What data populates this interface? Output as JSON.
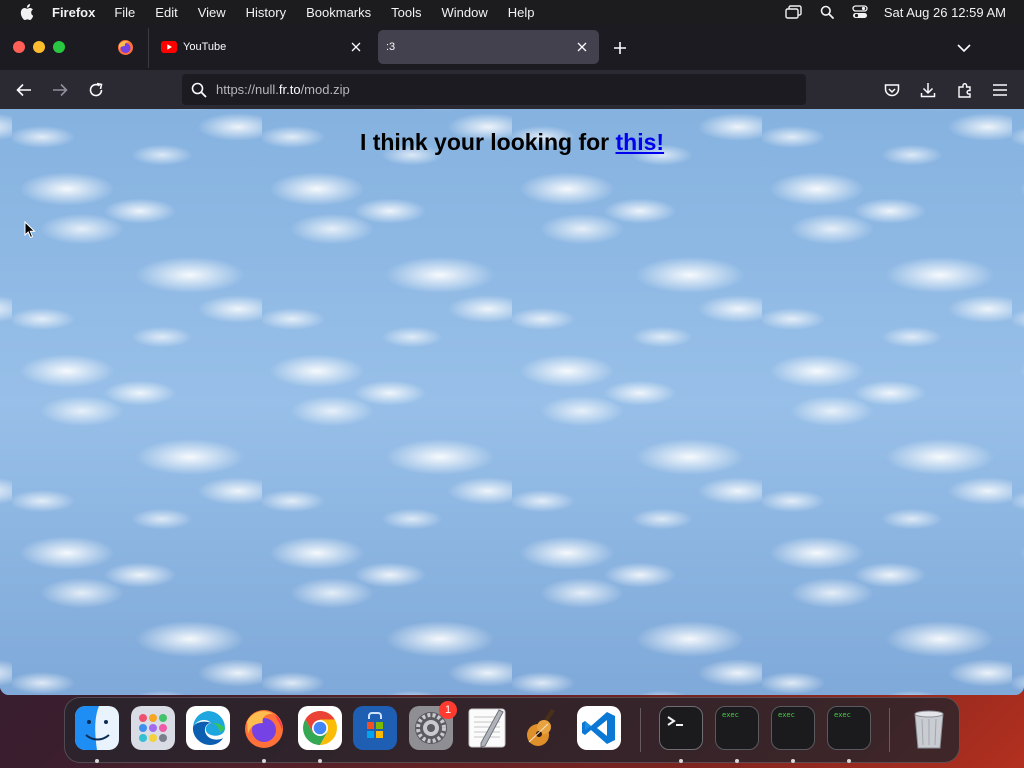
{
  "menubar": {
    "app_name": "Firefox",
    "items": [
      "File",
      "Edit",
      "View",
      "History",
      "Bookmarks",
      "Tools",
      "Window",
      "Help"
    ],
    "clock": "Sat Aug 26  12:59 AM",
    "status_icons": [
      "screen-mirroring-icon",
      "spotlight-search-icon",
      "control-center-icon"
    ]
  },
  "browser": {
    "tabs": [
      {
        "title": "YouTube",
        "icon": "youtube-icon",
        "active": false
      },
      {
        "title": ":3",
        "icon": "",
        "active": true
      }
    ],
    "url": {
      "prefix": "https://null.",
      "domain": "fr.to",
      "path": "/mod.zip"
    }
  },
  "page": {
    "headline": "I think your looking for ",
    "link_text": "this!",
    "link_color": "#0000ee",
    "background": "tiled-clouds"
  },
  "dock": {
    "apps": [
      {
        "name": "Finder",
        "icon": "finder-icon",
        "running": true
      },
      {
        "name": "Launchpad",
        "icon": "launchpad-icon",
        "running": false
      },
      {
        "name": "Microsoft Edge",
        "icon": "edge-icon",
        "running": false
      },
      {
        "name": "Firefox",
        "icon": "firefox-icon",
        "running": true
      },
      {
        "name": "Google Chrome",
        "icon": "chrome-icon",
        "running": true
      },
      {
        "name": "Microsoft Store",
        "icon": "store-icon",
        "running": false
      },
      {
        "name": "System Settings",
        "icon": "settings-icon",
        "running": false,
        "badge": "1"
      },
      {
        "name": "TextEdit",
        "icon": "textedit-icon",
        "running": false
      },
      {
        "name": "GarageBand",
        "icon": "garageband-icon",
        "running": false
      },
      {
        "name": "Visual Studio Code",
        "icon": "vscode-icon",
        "running": false
      },
      {
        "name": "Terminal",
        "icon": "terminal-icon",
        "running": true
      },
      {
        "name": "exec",
        "icon": "exec-icon",
        "running": true
      },
      {
        "name": "exec",
        "icon": "exec-icon",
        "running": true
      },
      {
        "name": "exec",
        "icon": "exec-icon",
        "running": true
      },
      {
        "name": "Trash",
        "icon": "trash-icon",
        "running": false
      }
    ],
    "exec_label": "exec",
    "badge_count": "1"
  },
  "colors": {
    "menubar": "#1c1c1e",
    "tabstrip": "#1c1b22",
    "toolbar": "#2b2a33",
    "active_tab": "#42414d",
    "link": "#0000ee"
  }
}
